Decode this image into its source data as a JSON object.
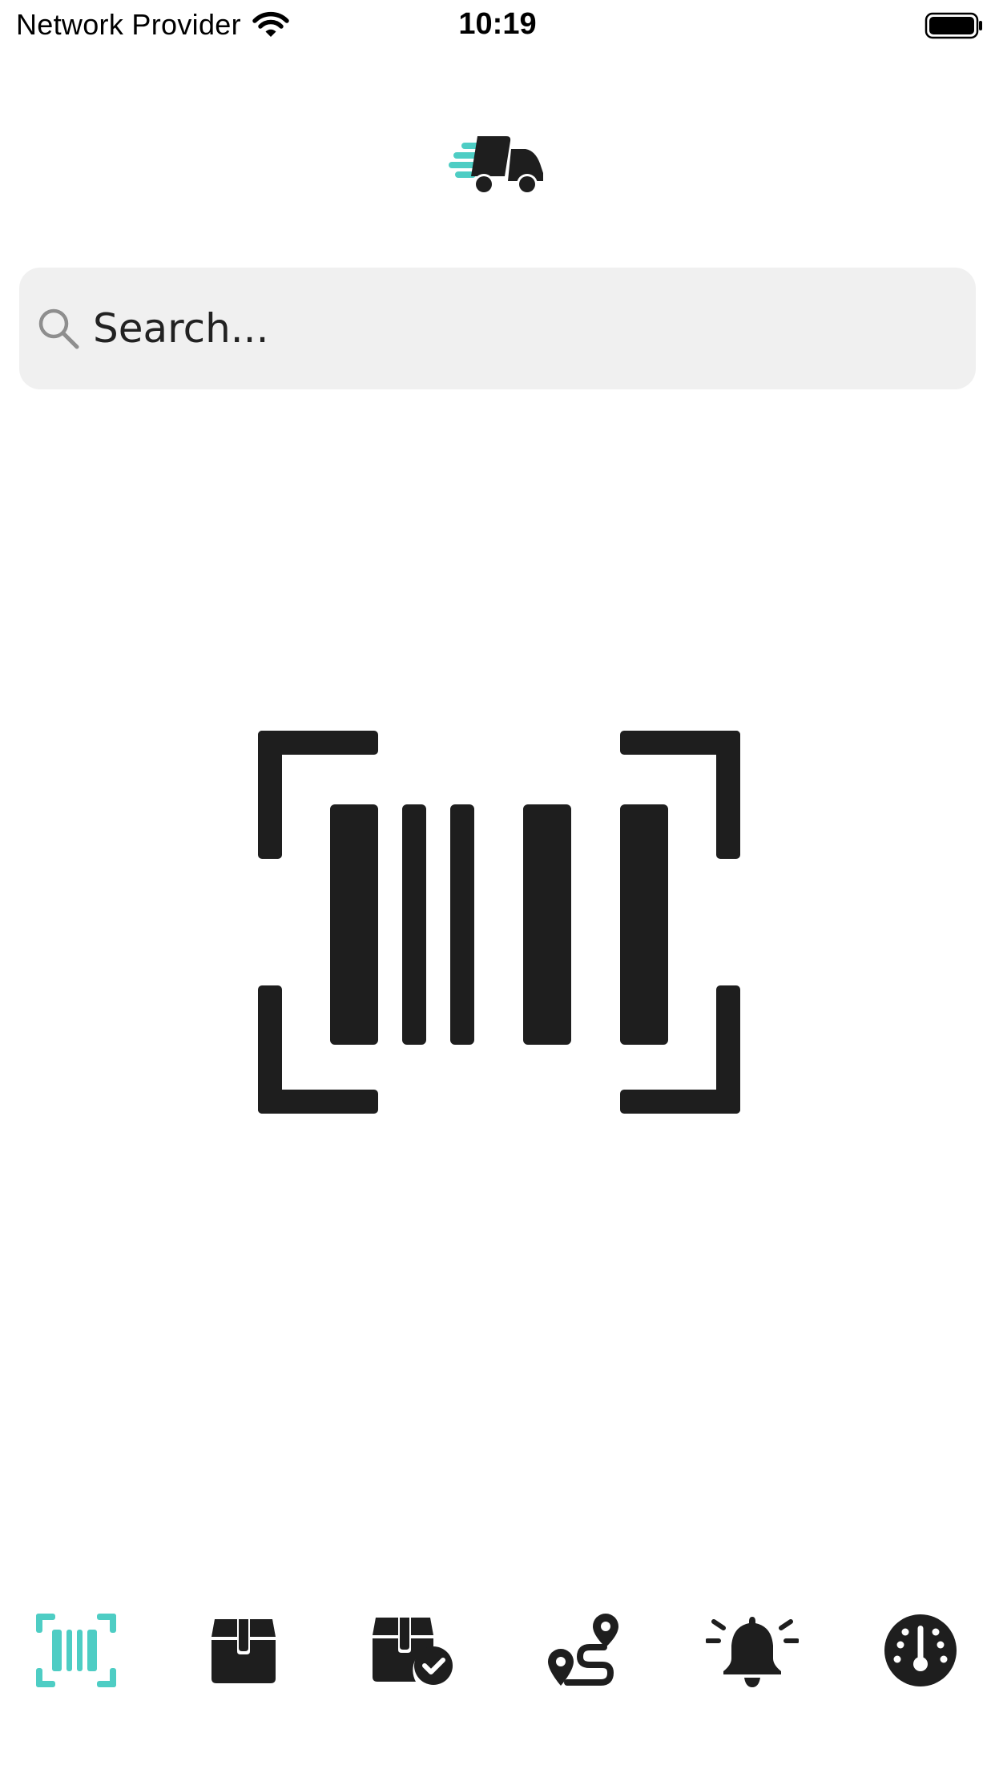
{
  "status_bar": {
    "carrier": "Network Provider",
    "time": "10:19"
  },
  "search": {
    "placeholder": "Search..."
  },
  "colors": {
    "accent": "#4ecdc4",
    "icon_dark": "#1e1e1e",
    "search_bg": "#f0f0f0"
  },
  "tabs": [
    {
      "icon": "barcode-scan-icon",
      "active": true
    },
    {
      "icon": "box-icon",
      "active": false
    },
    {
      "icon": "box-checked-icon",
      "active": false
    },
    {
      "icon": "route-icon",
      "active": false
    },
    {
      "icon": "bell-icon",
      "active": false
    },
    {
      "icon": "gauge-icon",
      "active": false
    }
  ]
}
